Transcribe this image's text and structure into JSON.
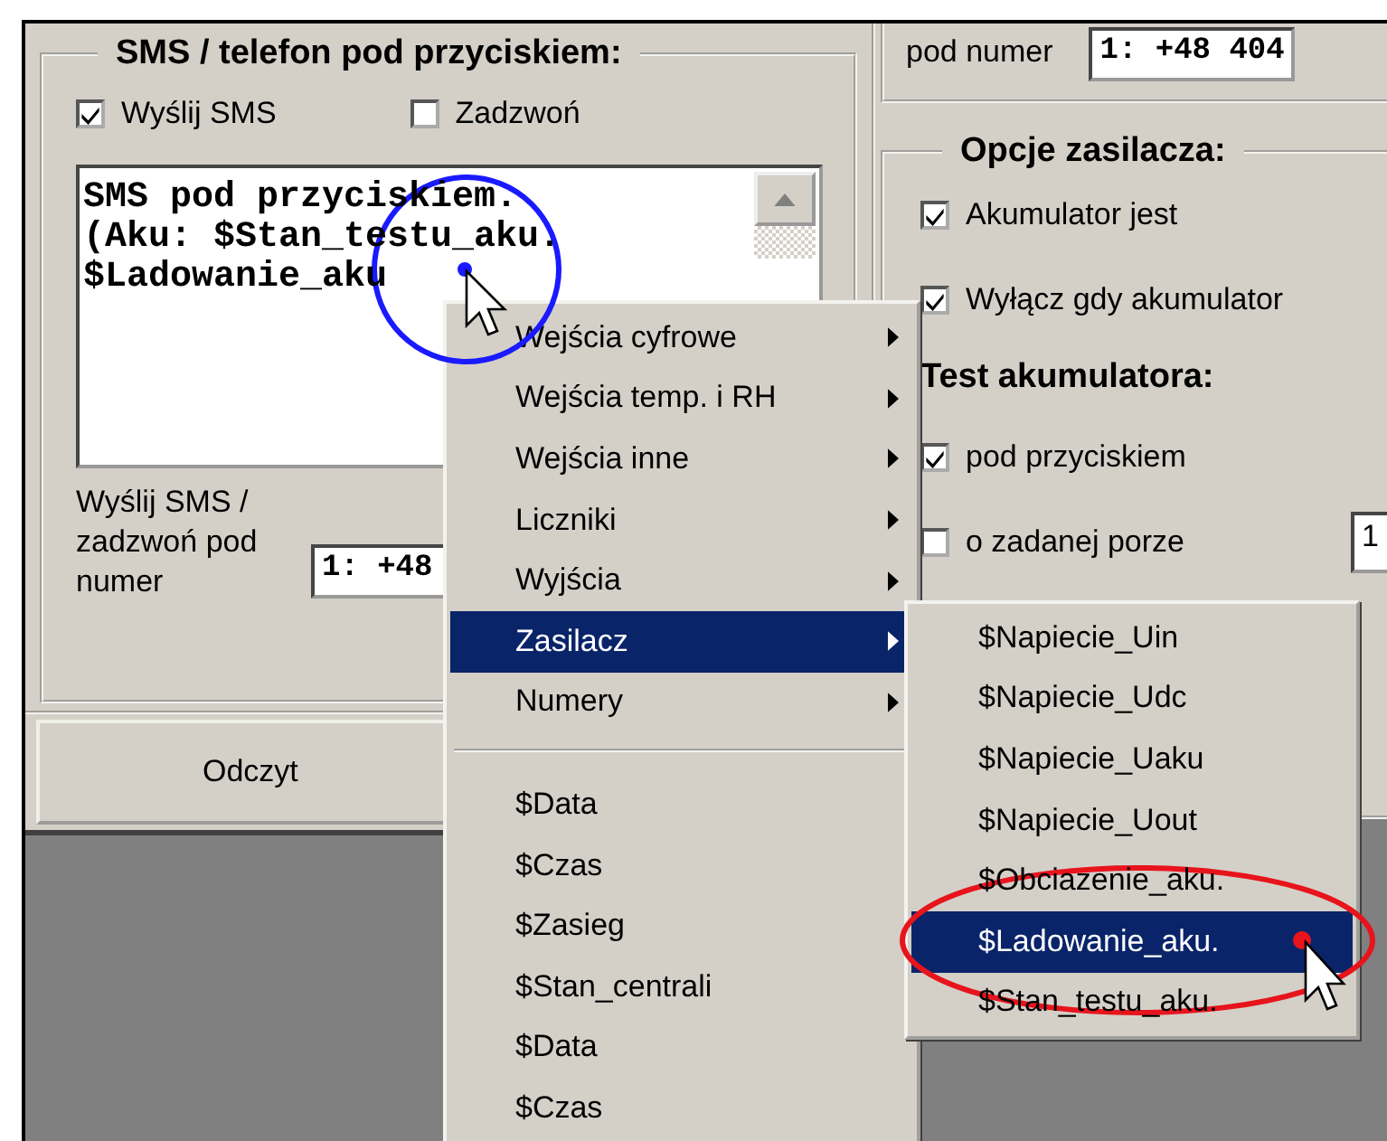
{
  "sms_group": {
    "title": "SMS / telefon pod przyciskiem:",
    "checkboxes": [
      {
        "label": "Wyślij SMS",
        "checked": true
      },
      {
        "label": "Zadzwoń",
        "checked": false
      }
    ],
    "message_lines": [
      "SMS pod przyciskiem.",
      "(Aku: $Stan_testu_aku.",
      "$Ladowanie_aku"
    ],
    "number_label": "Wyślij SMS / zadzwoń pod numer",
    "number_value": "1: +48"
  },
  "read_button": "Odczyt",
  "right_panel": {
    "number_label": "pod numer",
    "number_value": "1: +48 404",
    "power_group": {
      "title": "Opcje zasilacza:",
      "rows": [
        {
          "kind": "checkbox",
          "label": "Akumulator jest",
          "checked": true
        },
        {
          "kind": "checkbox",
          "label": "Wyłącz gdy akumulator",
          "checked": true
        },
        {
          "kind": "heading",
          "label": "Test akumulatora:"
        },
        {
          "kind": "checkbox",
          "label": "pod przyciskiem",
          "checked": true
        },
        {
          "kind": "checkbox",
          "label": "o zadanej porze",
          "checked": false,
          "field_value": "1"
        }
      ]
    }
  },
  "context_menu": {
    "items": [
      {
        "kind": "submenu",
        "label": "Wejścia cyfrowe",
        "selected": false
      },
      {
        "kind": "submenu",
        "label": "Wejścia temp. i RH",
        "selected": false
      },
      {
        "kind": "submenu",
        "label": "Wejścia inne",
        "selected": false
      },
      {
        "kind": "submenu",
        "label": "Liczniki",
        "selected": false
      },
      {
        "kind": "submenu",
        "label": "Wyjścia",
        "selected": false
      },
      {
        "kind": "submenu",
        "label": "Zasilacz",
        "selected": true
      },
      {
        "kind": "submenu",
        "label": "Numery",
        "selected": false
      },
      {
        "kind": "separator"
      },
      {
        "kind": "item",
        "label": "$Data",
        "selected": false
      },
      {
        "kind": "item",
        "label": "$Czas",
        "selected": false
      },
      {
        "kind": "item",
        "label": "$Zasieg",
        "selected": false
      },
      {
        "kind": "item",
        "label": "$Stan_centrali",
        "selected": false
      },
      {
        "kind": "item",
        "label": "$Data",
        "selected": false
      },
      {
        "kind": "item",
        "label": "$Czas",
        "selected": false
      }
    ]
  },
  "submenu": {
    "items": [
      {
        "label": "$Napiecie_Uin",
        "selected": false
      },
      {
        "label": "$Napiecie_Udc",
        "selected": false
      },
      {
        "label": "$Napiecie_Uaku",
        "selected": false
      },
      {
        "label": "$Napiecie_Uout",
        "selected": false
      },
      {
        "label": "$Obciazenie_aku.",
        "selected": false
      },
      {
        "label": "$Ladowanie_aku.",
        "selected": true
      },
      {
        "label": "$Stan_testu_aku.",
        "selected": false
      }
    ]
  }
}
